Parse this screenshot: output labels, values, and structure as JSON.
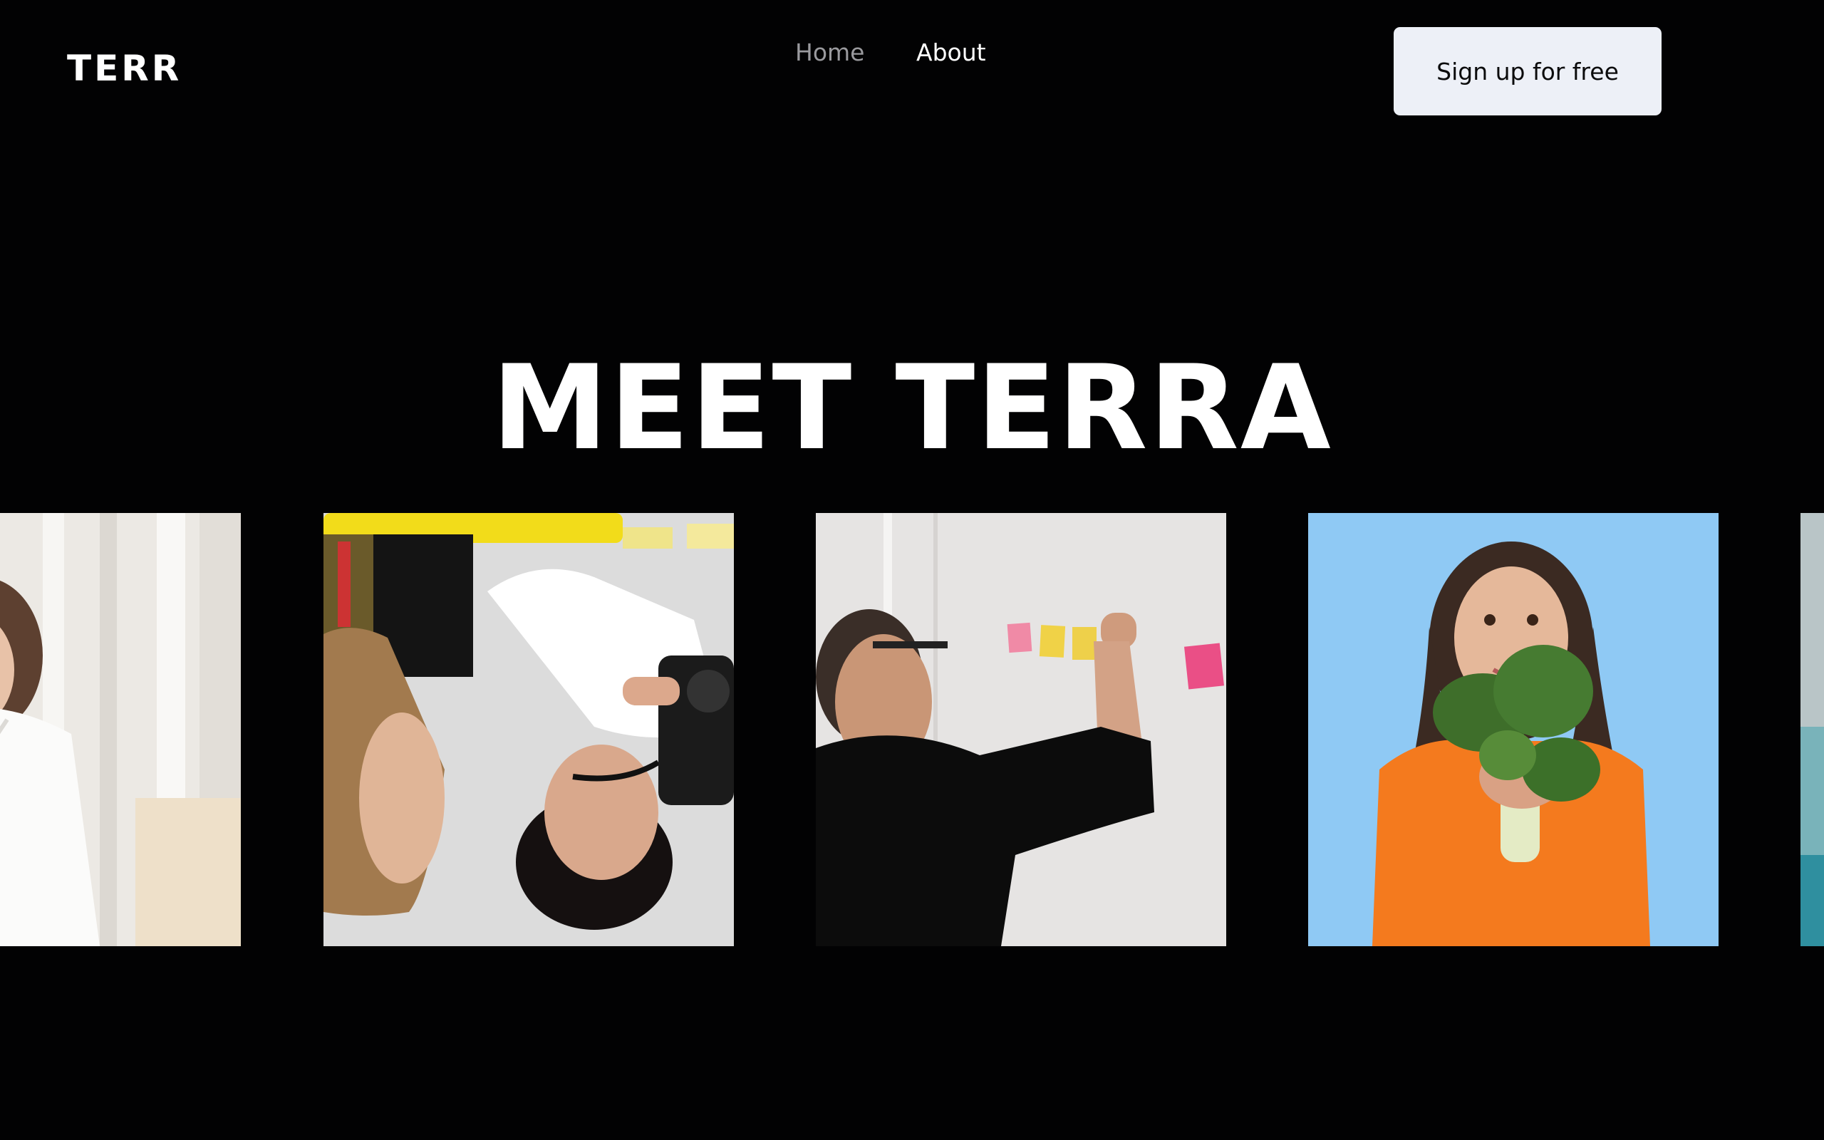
{
  "brand": {
    "logo": "TERR"
  },
  "nav": {
    "items": [
      "Home",
      "About"
    ]
  },
  "header": {
    "cta_label": "Sign up for free"
  },
  "hero": {
    "title": "MEET TERRA"
  },
  "colors": {
    "background": "#020203",
    "cta_background": "#edf0f7",
    "nav_inactive": "#9a9a9e",
    "nav_active": "#ffffff"
  },
  "gallery": {
    "photos": [
      {
        "icon": "woman-white-shirt-photo"
      },
      {
        "icon": "photographer-upside-down-photo"
      },
      {
        "icon": "man-sticky-notes-photo"
      },
      {
        "icon": "woman-orange-sweater-greens-photo"
      },
      {
        "icon": "partial-teal-photo"
      }
    ]
  }
}
